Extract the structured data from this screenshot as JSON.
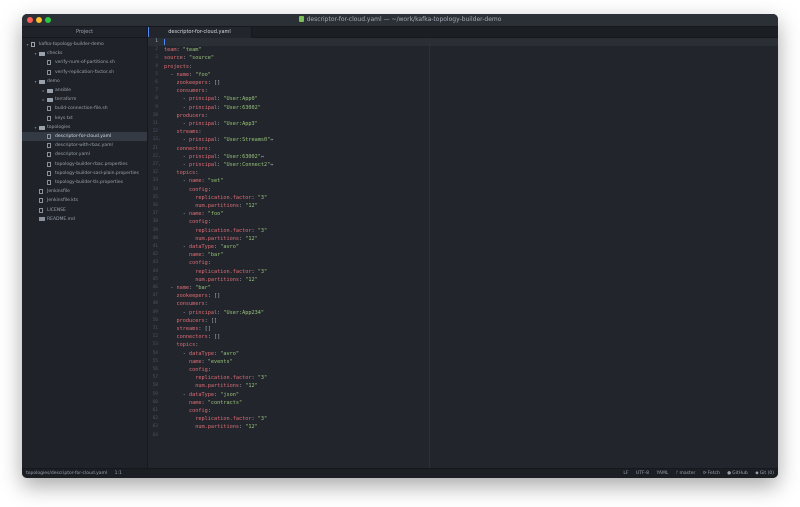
{
  "window": {
    "title": "descriptor-for-cloud.yaml — ~/work/kafka-topology-builder-demo"
  },
  "sidebar": {
    "header": "Project",
    "items": [
      {
        "label": "kafka-topology-builder-demo",
        "kind": "repo",
        "depth": 0,
        "expanded": true
      },
      {
        "label": "checks",
        "kind": "folder",
        "depth": 1,
        "expanded": true
      },
      {
        "label": "verify-num-of-partitions.sh",
        "kind": "file",
        "depth": 2
      },
      {
        "label": "verify-replication-factor.sh",
        "kind": "file",
        "depth": 2
      },
      {
        "label": "demo",
        "kind": "folder",
        "depth": 1,
        "expanded": true
      },
      {
        "label": "ansible",
        "kind": "folder",
        "depth": 2,
        "expanded": false
      },
      {
        "label": "terraform",
        "kind": "folder",
        "depth": 2,
        "expanded": false
      },
      {
        "label": "build-connection-file.sh",
        "kind": "file",
        "depth": 2
      },
      {
        "label": "keys.txt",
        "kind": "file",
        "depth": 2
      },
      {
        "label": "topologies",
        "kind": "folder",
        "depth": 1,
        "expanded": true
      },
      {
        "label": "descriptor-for-cloud.yaml",
        "kind": "file",
        "depth": 2,
        "selected": true
      },
      {
        "label": "descriptor-with-rbac.yaml",
        "kind": "file",
        "depth": 2
      },
      {
        "label": "descriptor.yaml",
        "kind": "file",
        "depth": 2
      },
      {
        "label": "topology-builder-rbac.properties",
        "kind": "file",
        "depth": 2
      },
      {
        "label": "topology-builder-sasl-plain.properties",
        "kind": "file",
        "depth": 2
      },
      {
        "label": "topology-builder-tls.properties",
        "kind": "file",
        "depth": 2
      },
      {
        "label": "Jenkinsfile",
        "kind": "file",
        "depth": 1
      },
      {
        "label": "Jenkinsfile.kts",
        "kind": "file",
        "depth": 1
      },
      {
        "label": "LICENSE",
        "kind": "file",
        "depth": 1
      },
      {
        "label": "README.md",
        "kind": "book",
        "depth": 1
      }
    ]
  },
  "tabs": [
    {
      "label": "descriptor-for-cloud.yaml",
      "active": true
    }
  ],
  "editor": {
    "lines": [
      {
        "n": "1",
        "t": []
      },
      {
        "n": "2",
        "t": [
          [
            "k",
            "team"
          ],
          [
            "p",
            ": "
          ],
          [
            "s",
            "\"team\""
          ]
        ]
      },
      {
        "n": "3",
        "t": [
          [
            "k",
            "source"
          ],
          [
            "p",
            ": "
          ],
          [
            "s",
            "\"source\""
          ]
        ]
      },
      {
        "n": "4",
        "t": [
          [
            "k",
            "projects"
          ],
          [
            "p",
            ":"
          ]
        ]
      },
      {
        "n": "5",
        "t": [
          [
            "p",
            "  - "
          ],
          [
            "k",
            "name"
          ],
          [
            "p",
            ": "
          ],
          [
            "s",
            "\"foo\""
          ]
        ]
      },
      {
        "n": "6",
        "t": [
          [
            "p",
            "    "
          ],
          [
            "k",
            "zookeepers"
          ],
          [
            "p",
            ": []"
          ]
        ]
      },
      {
        "n": "7",
        "t": [
          [
            "p",
            "    "
          ],
          [
            "k",
            "consumers"
          ],
          [
            "p",
            ":"
          ]
        ]
      },
      {
        "n": "8",
        "t": [
          [
            "p",
            "      - "
          ],
          [
            "k",
            "principal"
          ],
          [
            "p",
            ": "
          ],
          [
            "s",
            "\"User:App0\""
          ]
        ]
      },
      {
        "n": "9",
        "t": [
          [
            "p",
            "      - "
          ],
          [
            "k",
            "principal"
          ],
          [
            "p",
            ": "
          ],
          [
            "s",
            "\"User:63002\""
          ]
        ]
      },
      {
        "n": "10",
        "t": [
          [
            "p",
            "    "
          ],
          [
            "k",
            "producers"
          ],
          [
            "p",
            ":"
          ]
        ]
      },
      {
        "n": "11",
        "t": [
          [
            "p",
            "      - "
          ],
          [
            "k",
            "principal"
          ],
          [
            "p",
            ": "
          ],
          [
            "s",
            "\"User:App3\""
          ]
        ]
      },
      {
        "n": "12",
        "t": [
          [
            "p",
            "    "
          ],
          [
            "k",
            "streams"
          ],
          [
            "p",
            ":"
          ]
        ]
      },
      {
        "n": "13",
        "fold": true,
        "t": [
          [
            "p",
            "      - "
          ],
          [
            "k",
            "principal"
          ],
          [
            "p",
            ": "
          ],
          [
            "s",
            "\"User:Streams0\""
          ],
          [
            "p",
            "⇔"
          ]
        ]
      },
      {
        "n": "21",
        "t": [
          [
            "p",
            "    "
          ],
          [
            "k",
            "connectors"
          ],
          [
            "p",
            ":"
          ]
        ]
      },
      {
        "n": "22",
        "fold": true,
        "t": [
          [
            "p",
            "      - "
          ],
          [
            "k",
            "principal"
          ],
          [
            "p",
            ": "
          ],
          [
            "s",
            "\"User:63002\""
          ],
          [
            "p",
            "⇔"
          ]
        ]
      },
      {
        "n": "27",
        "fold": true,
        "t": [
          [
            "p",
            "      - "
          ],
          [
            "k",
            "principal"
          ],
          [
            "p",
            ": "
          ],
          [
            "s",
            "\"User:Connect2\""
          ],
          [
            "p",
            "⇔"
          ]
        ]
      },
      {
        "n": "32",
        "t": [
          [
            "p",
            "    "
          ],
          [
            "k",
            "topics"
          ],
          [
            "p",
            ":"
          ]
        ]
      },
      {
        "n": "33",
        "t": [
          [
            "p",
            "      - "
          ],
          [
            "k",
            "name"
          ],
          [
            "p",
            ": "
          ],
          [
            "s",
            "\"set\""
          ]
        ]
      },
      {
        "n": "34",
        "t": [
          [
            "p",
            "        "
          ],
          [
            "k",
            "config"
          ],
          [
            "p",
            ":"
          ]
        ]
      },
      {
        "n": "35",
        "t": [
          [
            "p",
            "          "
          ],
          [
            "k",
            "replication.factor"
          ],
          [
            "p",
            ": "
          ],
          [
            "s",
            "\"3\""
          ]
        ]
      },
      {
        "n": "36",
        "t": [
          [
            "p",
            "          "
          ],
          [
            "k",
            "num.partitions"
          ],
          [
            "p",
            ": "
          ],
          [
            "s",
            "\"12\""
          ]
        ]
      },
      {
        "n": "37",
        "t": [
          [
            "p",
            "      - "
          ],
          [
            "k",
            "name"
          ],
          [
            "p",
            ": "
          ],
          [
            "s",
            "\"foo\""
          ]
        ]
      },
      {
        "n": "38",
        "t": [
          [
            "p",
            "        "
          ],
          [
            "k",
            "config"
          ],
          [
            "p",
            ":"
          ]
        ]
      },
      {
        "n": "39",
        "t": [
          [
            "p",
            "          "
          ],
          [
            "k",
            "replication.factor"
          ],
          [
            "p",
            ": "
          ],
          [
            "s",
            "\"3\""
          ]
        ]
      },
      {
        "n": "40",
        "t": [
          [
            "p",
            "          "
          ],
          [
            "k",
            "num.partitions"
          ],
          [
            "p",
            ": "
          ],
          [
            "s",
            "\"12\""
          ]
        ]
      },
      {
        "n": "41",
        "t": [
          [
            "p",
            "      - "
          ],
          [
            "k",
            "dataType"
          ],
          [
            "p",
            ": "
          ],
          [
            "s",
            "\"avro\""
          ]
        ]
      },
      {
        "n": "42",
        "t": [
          [
            "p",
            "        "
          ],
          [
            "k",
            "name"
          ],
          [
            "p",
            ": "
          ],
          [
            "s",
            "\"bar\""
          ]
        ]
      },
      {
        "n": "43",
        "t": [
          [
            "p",
            "        "
          ],
          [
            "k",
            "config"
          ],
          [
            "p",
            ":"
          ]
        ]
      },
      {
        "n": "44",
        "t": [
          [
            "p",
            "          "
          ],
          [
            "k",
            "replication.factor"
          ],
          [
            "p",
            ": "
          ],
          [
            "s",
            "\"3\""
          ]
        ]
      },
      {
        "n": "45",
        "t": [
          [
            "p",
            "          "
          ],
          [
            "k",
            "num.partitions"
          ],
          [
            "p",
            ": "
          ],
          [
            "s",
            "\"12\""
          ]
        ]
      },
      {
        "n": "46",
        "t": [
          [
            "p",
            "  - "
          ],
          [
            "k",
            "name"
          ],
          [
            "p",
            ": "
          ],
          [
            "s",
            "\"bar\""
          ]
        ]
      },
      {
        "n": "47",
        "t": [
          [
            "p",
            "    "
          ],
          [
            "k",
            "zookeepers"
          ],
          [
            "p",
            ": []"
          ]
        ]
      },
      {
        "n": "48",
        "t": [
          [
            "p",
            "    "
          ],
          [
            "k",
            "consumers"
          ],
          [
            "p",
            ":"
          ]
        ]
      },
      {
        "n": "49",
        "t": [
          [
            "p",
            "      - "
          ],
          [
            "k",
            "principal"
          ],
          [
            "p",
            ": "
          ],
          [
            "s",
            "\"User:App234\""
          ]
        ]
      },
      {
        "n": "50",
        "t": [
          [
            "p",
            "    "
          ],
          [
            "k",
            "producers"
          ],
          [
            "p",
            ": []"
          ]
        ]
      },
      {
        "n": "51",
        "t": [
          [
            "p",
            "    "
          ],
          [
            "k",
            "streams"
          ],
          [
            "p",
            ": []"
          ]
        ]
      },
      {
        "n": "52",
        "t": [
          [
            "p",
            "    "
          ],
          [
            "k",
            "connectors"
          ],
          [
            "p",
            ": []"
          ]
        ]
      },
      {
        "n": "53",
        "t": [
          [
            "p",
            "    "
          ],
          [
            "k",
            "topics"
          ],
          [
            "p",
            ":"
          ]
        ]
      },
      {
        "n": "54",
        "t": [
          [
            "p",
            "      - "
          ],
          [
            "k",
            "dataType"
          ],
          [
            "p",
            ": "
          ],
          [
            "s",
            "\"avro\""
          ]
        ]
      },
      {
        "n": "55",
        "t": [
          [
            "p",
            "        "
          ],
          [
            "k",
            "name"
          ],
          [
            "p",
            ": "
          ],
          [
            "s",
            "\"events\""
          ]
        ]
      },
      {
        "n": "56",
        "t": [
          [
            "p",
            "        "
          ],
          [
            "k",
            "config"
          ],
          [
            "p",
            ":"
          ]
        ]
      },
      {
        "n": "57",
        "t": [
          [
            "p",
            "          "
          ],
          [
            "k",
            "replication.factor"
          ],
          [
            "p",
            ": "
          ],
          [
            "s",
            "\"3\""
          ]
        ]
      },
      {
        "n": "58",
        "t": [
          [
            "p",
            "          "
          ],
          [
            "k",
            "num.partitions"
          ],
          [
            "p",
            ": "
          ],
          [
            "s",
            "\"12\""
          ]
        ]
      },
      {
        "n": "59",
        "t": [
          [
            "p",
            "      - "
          ],
          [
            "k",
            "dataType"
          ],
          [
            "p",
            ": "
          ],
          [
            "s",
            "\"json\""
          ]
        ]
      },
      {
        "n": "60",
        "t": [
          [
            "p",
            "        "
          ],
          [
            "k",
            "name"
          ],
          [
            "p",
            ": "
          ],
          [
            "s",
            "\"contracts\""
          ]
        ]
      },
      {
        "n": "61",
        "t": [
          [
            "p",
            "        "
          ],
          [
            "k",
            "config"
          ],
          [
            "p",
            ":"
          ]
        ]
      },
      {
        "n": "62",
        "t": [
          [
            "p",
            "          "
          ],
          [
            "k",
            "replication.factor"
          ],
          [
            "p",
            ": "
          ],
          [
            "s",
            "\"3\""
          ]
        ]
      },
      {
        "n": "63",
        "t": [
          [
            "p",
            "          "
          ],
          [
            "k",
            "num.partitions"
          ],
          [
            "p",
            ": "
          ],
          [
            "s",
            "\"12\""
          ]
        ]
      },
      {
        "n": "64",
        "t": []
      }
    ]
  },
  "statusbar": {
    "file_path": "topologies/descriptor-for-cloud.yaml",
    "cursor_pos": "1:1",
    "line_ending": "LF",
    "encoding": "UTF-8",
    "grammar": "YAML",
    "branch": "master",
    "fetch": "Fetch",
    "github": "GitHub",
    "git": "Git (0)"
  },
  "colors": {
    "accent": "#568af2",
    "yaml_key": "#e06c75",
    "yaml_string": "#98c379"
  }
}
